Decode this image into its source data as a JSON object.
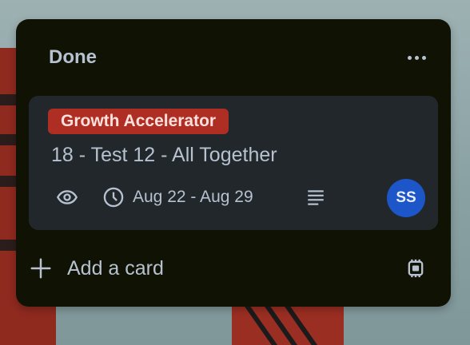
{
  "list": {
    "title": "Done",
    "more_icon": "ellipsis-icon"
  },
  "card": {
    "label": "Growth Accelerator",
    "label_color": "#ae2e24",
    "title": "18 - Test 12 - All Together",
    "badges": {
      "watch_icon": "eye-icon",
      "date_icon": "clock-icon",
      "dates": "Aug 22 - Aug 29",
      "description_icon": "description-icon"
    },
    "member": {
      "initials": "SS",
      "color": "#1d56c8"
    }
  },
  "footer": {
    "add_label": "Add a card",
    "add_icon": "plus-icon",
    "template_icon": "card-template-icon"
  },
  "colors": {
    "list_bg": "#101204",
    "card_bg": "#22272b",
    "text": "#b6c2cf"
  }
}
